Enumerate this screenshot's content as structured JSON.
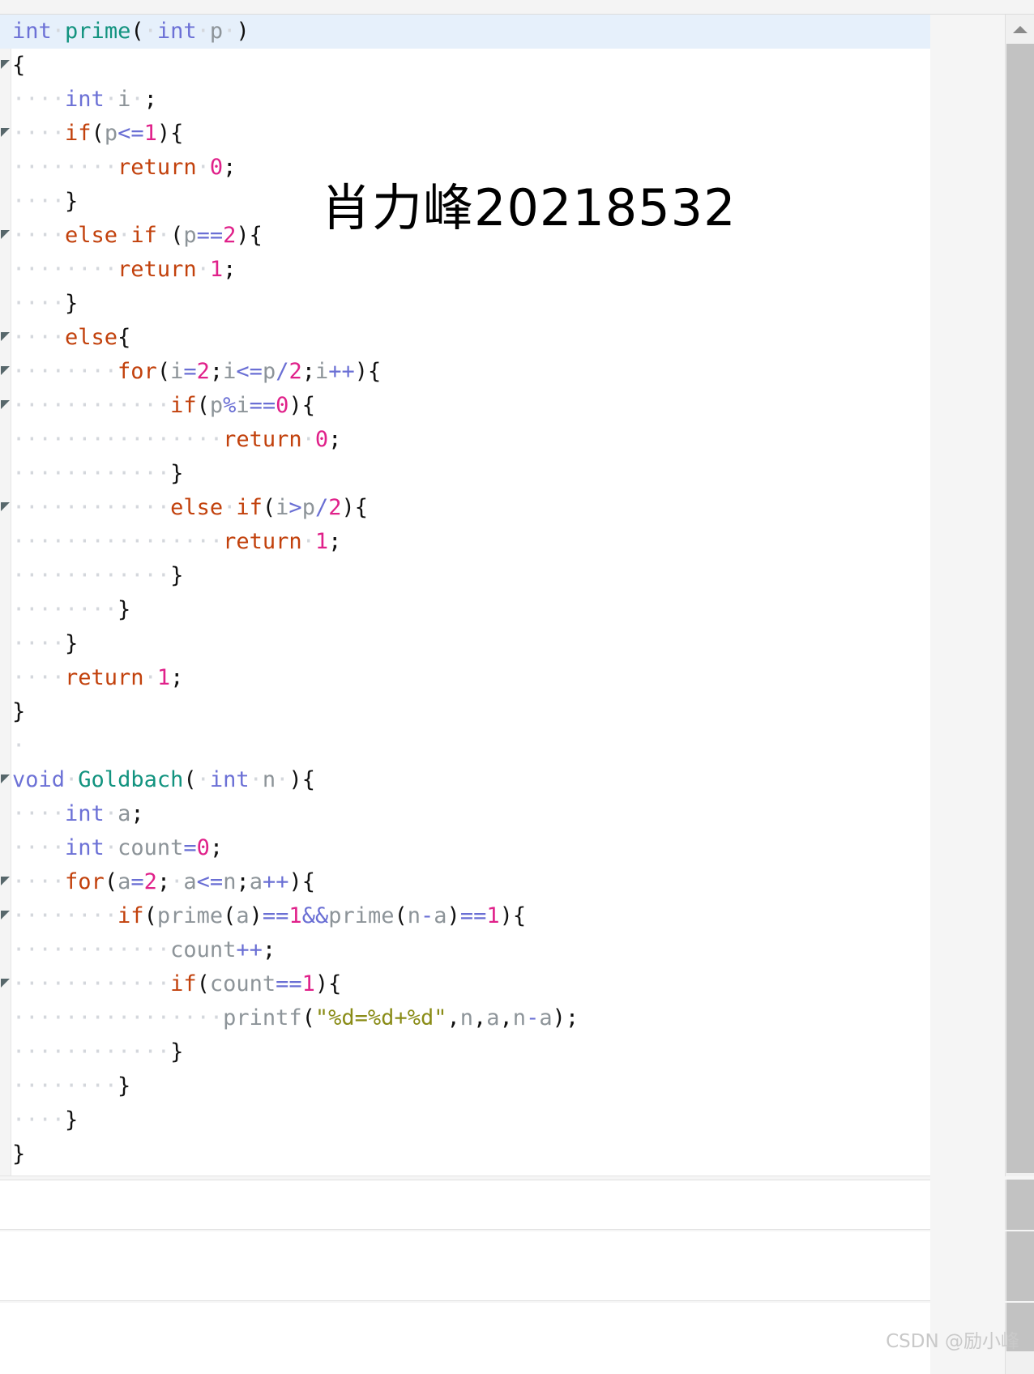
{
  "editor": {
    "language": "c",
    "current_line_index": 0,
    "whitespace_dot": "·",
    "colors": {
      "type": "#6c71d6",
      "function": "#12937f",
      "keyword": "#c2410c",
      "number": "#e0218a",
      "variable": "#8d9499",
      "operator": "#6a6fd4",
      "punctuation": "#111111",
      "string": "#8a8c17",
      "whitespace": "#d4d7dc",
      "current_line_bg": "#e6f0fb",
      "gutter_bg": "#f4f4f4",
      "fold_marker": "#57676b",
      "scrollbar_thumb": "#c2c2c2",
      "page_bg": "#ffffff"
    },
    "lines": [
      {
        "fold": false,
        "current": true,
        "tokens": [
          {
            "t": "type",
            "v": "int"
          },
          {
            "t": "ws",
            "v": "·"
          },
          {
            "t": "fn",
            "v": "prime"
          },
          {
            "t": "punc",
            "v": "("
          },
          {
            "t": "ws",
            "v": "·"
          },
          {
            "t": "type",
            "v": "int"
          },
          {
            "t": "ws",
            "v": "·"
          },
          {
            "t": "var",
            "v": "p"
          },
          {
            "t": "ws",
            "v": "·"
          },
          {
            "t": "punc",
            "v": ")"
          }
        ]
      },
      {
        "fold": true,
        "current": false,
        "tokens": [
          {
            "t": "punc",
            "v": "{"
          }
        ]
      },
      {
        "fold": false,
        "current": false,
        "tokens": [
          {
            "t": "ws",
            "v": "····"
          },
          {
            "t": "type",
            "v": "int"
          },
          {
            "t": "ws",
            "v": "·"
          },
          {
            "t": "var",
            "v": "i"
          },
          {
            "t": "ws",
            "v": "·"
          },
          {
            "t": "punc",
            "v": ";"
          }
        ]
      },
      {
        "fold": true,
        "current": false,
        "tokens": [
          {
            "t": "ws",
            "v": "····"
          },
          {
            "t": "kw",
            "v": "if"
          },
          {
            "t": "punc",
            "v": "("
          },
          {
            "t": "var",
            "v": "p"
          },
          {
            "t": "op",
            "v": "<="
          },
          {
            "t": "num",
            "v": "1"
          },
          {
            "t": "punc",
            "v": "){"
          }
        ]
      },
      {
        "fold": false,
        "current": false,
        "tokens": [
          {
            "t": "ws",
            "v": "········"
          },
          {
            "t": "kw",
            "v": "return"
          },
          {
            "t": "ws",
            "v": "·"
          },
          {
            "t": "num",
            "v": "0"
          },
          {
            "t": "punc",
            "v": ";"
          }
        ]
      },
      {
        "fold": false,
        "current": false,
        "tokens": [
          {
            "t": "ws",
            "v": "····"
          },
          {
            "t": "punc",
            "v": "}"
          }
        ]
      },
      {
        "fold": true,
        "current": false,
        "tokens": [
          {
            "t": "ws",
            "v": "····"
          },
          {
            "t": "kw",
            "v": "else"
          },
          {
            "t": "ws",
            "v": "·"
          },
          {
            "t": "kw",
            "v": "if"
          },
          {
            "t": "ws",
            "v": "·"
          },
          {
            "t": "punc",
            "v": "("
          },
          {
            "t": "var",
            "v": "p"
          },
          {
            "t": "op",
            "v": "=="
          },
          {
            "t": "num",
            "v": "2"
          },
          {
            "t": "punc",
            "v": "){"
          }
        ]
      },
      {
        "fold": false,
        "current": false,
        "tokens": [
          {
            "t": "ws",
            "v": "········"
          },
          {
            "t": "kw",
            "v": "return"
          },
          {
            "t": "ws",
            "v": "·"
          },
          {
            "t": "num",
            "v": "1"
          },
          {
            "t": "punc",
            "v": ";"
          }
        ]
      },
      {
        "fold": false,
        "current": false,
        "tokens": [
          {
            "t": "ws",
            "v": "····"
          },
          {
            "t": "punc",
            "v": "}"
          }
        ]
      },
      {
        "fold": true,
        "current": false,
        "tokens": [
          {
            "t": "ws",
            "v": "····"
          },
          {
            "t": "kw",
            "v": "else"
          },
          {
            "t": "punc",
            "v": "{"
          }
        ]
      },
      {
        "fold": true,
        "current": false,
        "tokens": [
          {
            "t": "ws",
            "v": "········"
          },
          {
            "t": "kw",
            "v": "for"
          },
          {
            "t": "punc",
            "v": "("
          },
          {
            "t": "var",
            "v": "i"
          },
          {
            "t": "op",
            "v": "="
          },
          {
            "t": "num",
            "v": "2"
          },
          {
            "t": "punc",
            "v": ";"
          },
          {
            "t": "var",
            "v": "i"
          },
          {
            "t": "op",
            "v": "<="
          },
          {
            "t": "var",
            "v": "p"
          },
          {
            "t": "op",
            "v": "/"
          },
          {
            "t": "num",
            "v": "2"
          },
          {
            "t": "punc",
            "v": ";"
          },
          {
            "t": "var",
            "v": "i"
          },
          {
            "t": "op",
            "v": "++"
          },
          {
            "t": "punc",
            "v": "){"
          }
        ]
      },
      {
        "fold": true,
        "current": false,
        "tokens": [
          {
            "t": "ws",
            "v": "············"
          },
          {
            "t": "kw",
            "v": "if"
          },
          {
            "t": "punc",
            "v": "("
          },
          {
            "t": "var",
            "v": "p"
          },
          {
            "t": "op",
            "v": "%"
          },
          {
            "t": "var",
            "v": "i"
          },
          {
            "t": "op",
            "v": "=="
          },
          {
            "t": "num",
            "v": "0"
          },
          {
            "t": "punc",
            "v": "){"
          }
        ]
      },
      {
        "fold": false,
        "current": false,
        "tokens": [
          {
            "t": "ws",
            "v": "················"
          },
          {
            "t": "kw",
            "v": "return"
          },
          {
            "t": "ws",
            "v": "·"
          },
          {
            "t": "num",
            "v": "0"
          },
          {
            "t": "punc",
            "v": ";"
          }
        ]
      },
      {
        "fold": false,
        "current": false,
        "tokens": [
          {
            "t": "ws",
            "v": "············"
          },
          {
            "t": "punc",
            "v": "}"
          }
        ]
      },
      {
        "fold": true,
        "current": false,
        "tokens": [
          {
            "t": "ws",
            "v": "············"
          },
          {
            "t": "kw",
            "v": "else"
          },
          {
            "t": "ws",
            "v": "·"
          },
          {
            "t": "kw",
            "v": "if"
          },
          {
            "t": "punc",
            "v": "("
          },
          {
            "t": "var",
            "v": "i"
          },
          {
            "t": "op",
            "v": ">"
          },
          {
            "t": "var",
            "v": "p"
          },
          {
            "t": "op",
            "v": "/"
          },
          {
            "t": "num",
            "v": "2"
          },
          {
            "t": "punc",
            "v": "){"
          }
        ]
      },
      {
        "fold": false,
        "current": false,
        "tokens": [
          {
            "t": "ws",
            "v": "················"
          },
          {
            "t": "kw",
            "v": "return"
          },
          {
            "t": "ws",
            "v": "·"
          },
          {
            "t": "num",
            "v": "1"
          },
          {
            "t": "punc",
            "v": ";"
          }
        ]
      },
      {
        "fold": false,
        "current": false,
        "tokens": [
          {
            "t": "ws",
            "v": "············"
          },
          {
            "t": "punc",
            "v": "}"
          }
        ]
      },
      {
        "fold": false,
        "current": false,
        "tokens": [
          {
            "t": "ws",
            "v": "········"
          },
          {
            "t": "punc",
            "v": "}"
          }
        ]
      },
      {
        "fold": false,
        "current": false,
        "tokens": [
          {
            "t": "ws",
            "v": "····"
          },
          {
            "t": "punc",
            "v": "}"
          }
        ]
      },
      {
        "fold": false,
        "current": false,
        "tokens": [
          {
            "t": "ws",
            "v": "····"
          },
          {
            "t": "kw",
            "v": "return"
          },
          {
            "t": "ws",
            "v": "·"
          },
          {
            "t": "num",
            "v": "1"
          },
          {
            "t": "punc",
            "v": ";"
          }
        ]
      },
      {
        "fold": false,
        "current": false,
        "tokens": [
          {
            "t": "punc",
            "v": "}"
          }
        ]
      },
      {
        "fold": false,
        "current": false,
        "tokens": [
          {
            "t": "ws",
            "v": "·"
          }
        ]
      },
      {
        "fold": true,
        "current": false,
        "tokens": [
          {
            "t": "type",
            "v": "void"
          },
          {
            "t": "ws",
            "v": "·"
          },
          {
            "t": "fn",
            "v": "Goldbach"
          },
          {
            "t": "punc",
            "v": "("
          },
          {
            "t": "ws",
            "v": "·"
          },
          {
            "t": "type",
            "v": "int"
          },
          {
            "t": "ws",
            "v": "·"
          },
          {
            "t": "var",
            "v": "n"
          },
          {
            "t": "ws",
            "v": "·"
          },
          {
            "t": "punc",
            "v": "){"
          }
        ]
      },
      {
        "fold": false,
        "current": false,
        "tokens": [
          {
            "t": "ws",
            "v": "····"
          },
          {
            "t": "type",
            "v": "int"
          },
          {
            "t": "ws",
            "v": "·"
          },
          {
            "t": "var",
            "v": "a"
          },
          {
            "t": "punc",
            "v": ";"
          }
        ]
      },
      {
        "fold": false,
        "current": false,
        "tokens": [
          {
            "t": "ws",
            "v": "····"
          },
          {
            "t": "type",
            "v": "int"
          },
          {
            "t": "ws",
            "v": "·"
          },
          {
            "t": "var",
            "v": "count"
          },
          {
            "t": "op",
            "v": "="
          },
          {
            "t": "num",
            "v": "0"
          },
          {
            "t": "punc",
            "v": ";"
          }
        ]
      },
      {
        "fold": true,
        "current": false,
        "tokens": [
          {
            "t": "ws",
            "v": "····"
          },
          {
            "t": "kw",
            "v": "for"
          },
          {
            "t": "punc",
            "v": "("
          },
          {
            "t": "var",
            "v": "a"
          },
          {
            "t": "op",
            "v": "="
          },
          {
            "t": "num",
            "v": "2"
          },
          {
            "t": "punc",
            "v": ";"
          },
          {
            "t": "ws",
            "v": "·"
          },
          {
            "t": "var",
            "v": "a"
          },
          {
            "t": "op",
            "v": "<="
          },
          {
            "t": "var",
            "v": "n"
          },
          {
            "t": "punc",
            "v": ";"
          },
          {
            "t": "var",
            "v": "a"
          },
          {
            "t": "op",
            "v": "++"
          },
          {
            "t": "punc",
            "v": "){"
          }
        ]
      },
      {
        "fold": true,
        "current": false,
        "tokens": [
          {
            "t": "ws",
            "v": "········"
          },
          {
            "t": "kw",
            "v": "if"
          },
          {
            "t": "punc",
            "v": "("
          },
          {
            "t": "var",
            "v": "prime"
          },
          {
            "t": "punc",
            "v": "("
          },
          {
            "t": "var",
            "v": "a"
          },
          {
            "t": "punc",
            "v": ")"
          },
          {
            "t": "op",
            "v": "=="
          },
          {
            "t": "num",
            "v": "1"
          },
          {
            "t": "op",
            "v": "&&"
          },
          {
            "t": "var",
            "v": "prime"
          },
          {
            "t": "punc",
            "v": "("
          },
          {
            "t": "var",
            "v": "n"
          },
          {
            "t": "op",
            "v": "-"
          },
          {
            "t": "var",
            "v": "a"
          },
          {
            "t": "punc",
            "v": ")"
          },
          {
            "t": "op",
            "v": "=="
          },
          {
            "t": "num",
            "v": "1"
          },
          {
            "t": "punc",
            "v": "){"
          }
        ]
      },
      {
        "fold": false,
        "current": false,
        "tokens": [
          {
            "t": "ws",
            "v": "············"
          },
          {
            "t": "var",
            "v": "count"
          },
          {
            "t": "op",
            "v": "++"
          },
          {
            "t": "punc",
            "v": ";"
          }
        ]
      },
      {
        "fold": true,
        "current": false,
        "tokens": [
          {
            "t": "ws",
            "v": "············"
          },
          {
            "t": "kw",
            "v": "if"
          },
          {
            "t": "punc",
            "v": "("
          },
          {
            "t": "var",
            "v": "count"
          },
          {
            "t": "op",
            "v": "=="
          },
          {
            "t": "num",
            "v": "1"
          },
          {
            "t": "punc",
            "v": "){"
          }
        ]
      },
      {
        "fold": false,
        "current": false,
        "tokens": [
          {
            "t": "ws",
            "v": "················"
          },
          {
            "t": "var",
            "v": "printf"
          },
          {
            "t": "punc",
            "v": "("
          },
          {
            "t": "str",
            "v": "\"%d=%d+%d\""
          },
          {
            "t": "punc",
            "v": ","
          },
          {
            "t": "var",
            "v": "n"
          },
          {
            "t": "punc",
            "v": ","
          },
          {
            "t": "var",
            "v": "a"
          },
          {
            "t": "punc",
            "v": ","
          },
          {
            "t": "var",
            "v": "n"
          },
          {
            "t": "op",
            "v": "-"
          },
          {
            "t": "var",
            "v": "a"
          },
          {
            "t": "punc",
            "v": ");"
          }
        ]
      },
      {
        "fold": false,
        "current": false,
        "tokens": [
          {
            "t": "ws",
            "v": "············"
          },
          {
            "t": "punc",
            "v": "}"
          }
        ]
      },
      {
        "fold": false,
        "current": false,
        "tokens": [
          {
            "t": "ws",
            "v": "········"
          },
          {
            "t": "punc",
            "v": "}"
          }
        ]
      },
      {
        "fold": false,
        "current": false,
        "tokens": [
          {
            "t": "ws",
            "v": "····"
          },
          {
            "t": "punc",
            "v": "}"
          }
        ]
      },
      {
        "fold": false,
        "current": false,
        "tokens": [
          {
            "t": "punc",
            "v": "}"
          }
        ]
      }
    ]
  },
  "overlays": {
    "author_watermark": "肖力峰20218532",
    "csdn_watermark": "CSDN @励小峰"
  },
  "scrollbar": {
    "up_arrow": "scroll-up-arrow",
    "thumb": "scroll-thumb"
  }
}
